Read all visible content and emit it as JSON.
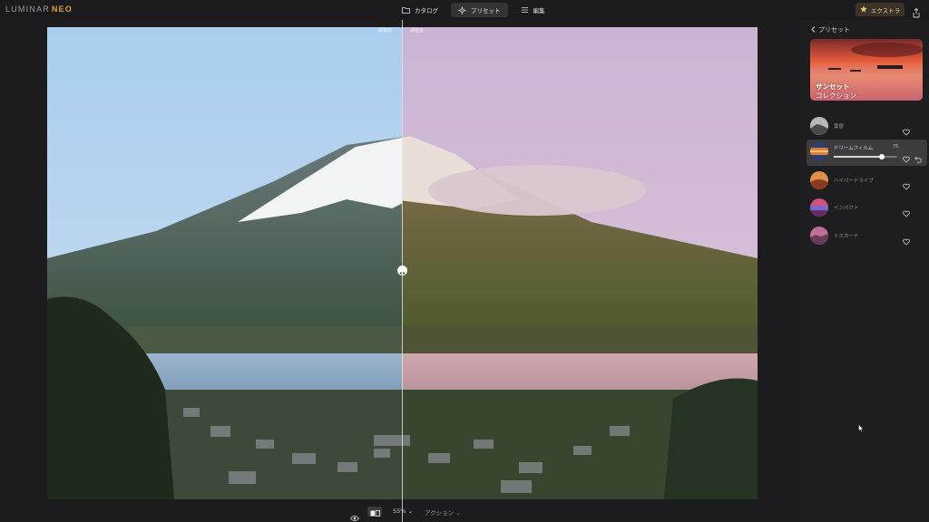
{
  "app": {
    "logo": "LUMINAR",
    "logo_suffix": "NEO"
  },
  "tabs": [
    {
      "label": "カタログ",
      "icon": "folder-icon"
    },
    {
      "label": "プリセット",
      "icon": "sparkle-icon",
      "active": true
    },
    {
      "label": "編集",
      "icon": "sliders-icon"
    }
  ],
  "extra_button": {
    "label": "エクストラ",
    "icon": "star-icon"
  },
  "canvas": {
    "before_label": "調整前",
    "after_label": "調整後"
  },
  "bottom": {
    "zoom": "55%",
    "actions": "アクション"
  },
  "panel": {
    "back_label": "プリセット",
    "collection": {
      "title": "サンセット",
      "subtitle": "コレクション"
    },
    "presets": [
      {
        "name": "黄昏",
        "thumb_color": "#8a8a8a"
      },
      {
        "name": "ドリームフィルム",
        "value": 75,
        "slider_fraction": 0.75,
        "thumb_color": "#d07a33"
      },
      {
        "name": "ハイパードライブ",
        "thumb_color": "#c8742e"
      },
      {
        "name": "インパクト",
        "thumb_color": "#b0446f"
      },
      {
        "name": "トスカーナ",
        "thumb_color": "#9a5a8c"
      }
    ]
  },
  "colors": {
    "accent": "#d7a23a",
    "panel_bg": "#1e1e20",
    "active_row": "#3d3d3f"
  }
}
